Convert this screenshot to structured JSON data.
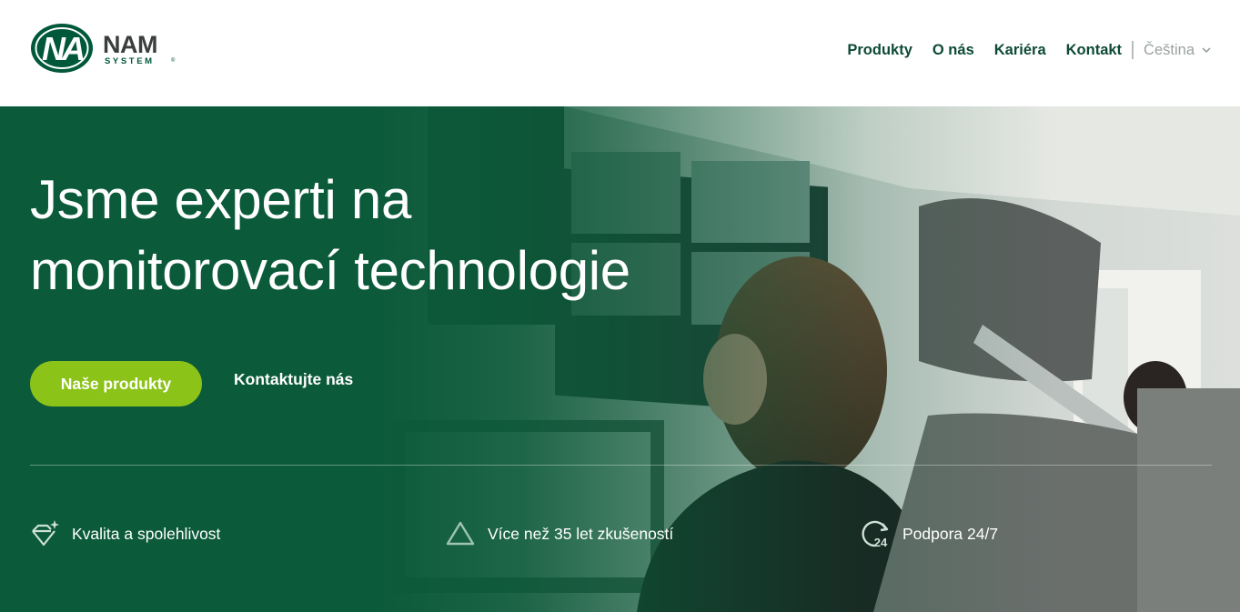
{
  "brand": {
    "mark": "NA",
    "name": "NAM",
    "sub": "SYSTEM",
    "registered": "®",
    "colors": {
      "green": "#00583a",
      "gray": "#3a3f3d"
    }
  },
  "nav": {
    "items": [
      "Produkty",
      "O nás",
      "Kariéra",
      "Kontakt"
    ],
    "language": "Čeština",
    "color": "#0d4a35"
  },
  "hero": {
    "title_line1": "Jsme experti na",
    "title_line2": "monitorovací technologie",
    "primary_button": "Naše produkty",
    "secondary_link": "Kontaktujte nás",
    "accent": "#8cc319",
    "background": "#0b5a3a"
  },
  "features": [
    {
      "icon": "diamond-sparkle-icon",
      "label": "Kvalita a spolehlivost"
    },
    {
      "icon": "triangle-icon",
      "label": "Více než 35 let zkušeností"
    },
    {
      "icon": "support-24-icon",
      "label": "Podpora 24/7"
    }
  ]
}
